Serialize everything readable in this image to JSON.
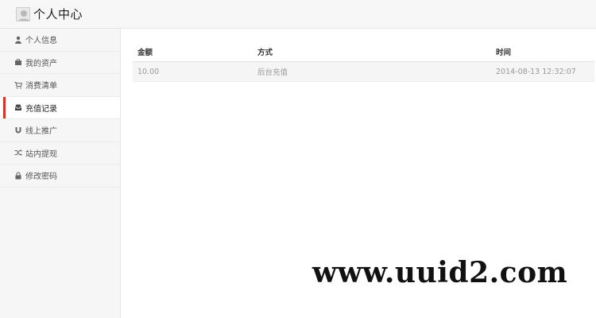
{
  "header": {
    "title": "个人中心",
    "avatar_icon": "user-avatar-icon"
  },
  "sidebar": {
    "items": [
      {
        "label": "个人信息",
        "icon": "user-icon"
      },
      {
        "label": "我的资产",
        "icon": "briefcase-icon"
      },
      {
        "label": "消费清单",
        "icon": "cart-icon"
      },
      {
        "label": "充值记录",
        "icon": "inbox-icon",
        "active": true
      },
      {
        "label": "线上推广",
        "icon": "magnet-icon"
      },
      {
        "label": "站内提现",
        "icon": "shuffle-icon"
      },
      {
        "label": "修改密码",
        "icon": "lock-icon"
      }
    ],
    "active_color": "#d9302c"
  },
  "table": {
    "headers": [
      "金额",
      "方式",
      "时间"
    ],
    "rows": [
      [
        "10.00",
        "后台充值",
        "2014-08-13 12:32:07"
      ]
    ]
  },
  "watermark": "www.uuid2.com"
}
